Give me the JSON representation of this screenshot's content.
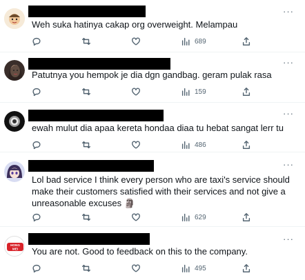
{
  "tweets": [
    {
      "avatar_icon": "cartoon-face-avatar",
      "text": "Weh suka hatinya cakap org overweight. Melampau",
      "views": "689",
      "more_label": "···"
    },
    {
      "avatar_icon": "woman-photo-avatar",
      "text": "Patutnya you hempok je dia dgn gandbag. geram pulak rasa",
      "views": "159",
      "more_label": "···"
    },
    {
      "avatar_icon": "dark-circle-avatar",
      "text": "ewah mulut dia apaa kereta hondaa diaa tu hebat sangat lerr tu",
      "views": "486",
      "more_label": "···"
    },
    {
      "avatar_icon": "anime-girl-avatar",
      "text": "Lol bad service I think every person who are taxi's service should make their customers satisfied with their services and not give a unreasonable excuses 🗿",
      "views": "629",
      "more_label": "···"
    },
    {
      "avatar_icon": "hong-mei-logo-avatar",
      "logo_text": "HONG MEI",
      "text": "You are not. Good to feedback on this to the company.",
      "views": "495",
      "more_label": "···"
    }
  ],
  "colors": {
    "text": "#0f1419",
    "secondary": "#536471",
    "divider": "#eff3f4",
    "redacted": "#000000"
  }
}
